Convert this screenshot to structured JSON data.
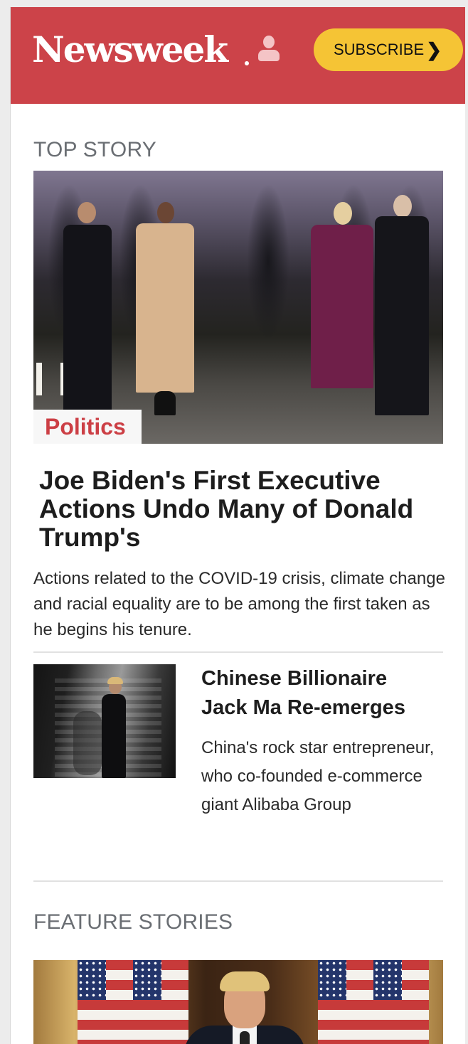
{
  "header": {
    "logo_text": "Newsweek",
    "subscribe_label": "SUBSCRIBE",
    "subscribe_chevron": "❯",
    "user_icon": "user-icon",
    "colors": {
      "brand": "#cc4349",
      "subscribe_bg": "#f5c435"
    }
  },
  "top_story": {
    "section_label": "TOP STORY",
    "category": "Politics",
    "headline": "Joe Biden's First Executive Actions Undo Many of Donald Trump's",
    "dek": "Actions related to the COVID-19 crisis, climate change and racial equality are to be among the first taken as he begins his tenure."
  },
  "secondary_story": {
    "headline": "Chinese Billionaire Jack Ma Re-emerges",
    "dek": "China's rock star entrepreneur, who co-founded e-commerce giant Alibaba Group"
  },
  "feature_stories": {
    "section_label": "FEATURE STORIES"
  }
}
